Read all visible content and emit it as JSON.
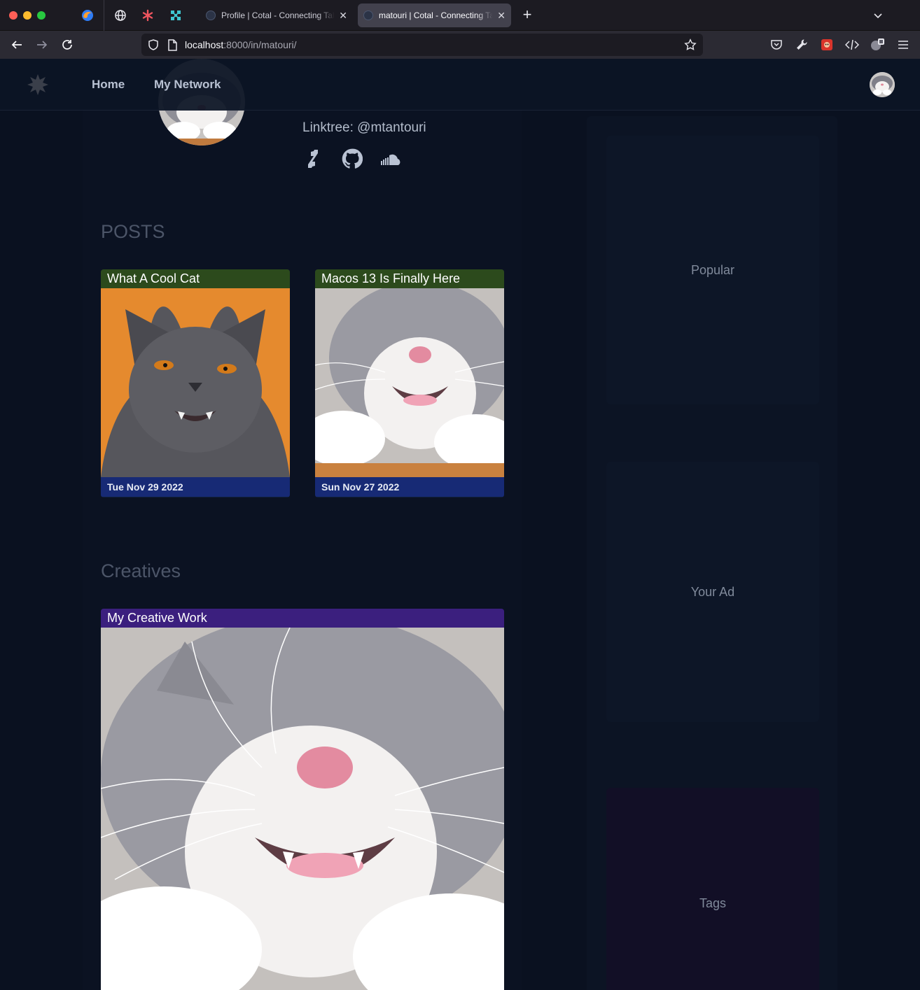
{
  "browser": {
    "tabs": [
      {
        "title": "Profile | Cotal - Connecting Talent",
        "active": false
      },
      {
        "title": "matouri | Cotal - Connecting Talent",
        "active": true
      }
    ],
    "url_host": "localhost",
    "url_path": ":8000/in/matouri/",
    "icons": [
      "firefox-icon",
      "globe-icon",
      "asterisk-icon",
      "puzzle-icon",
      "star-icon",
      "pocket-icon",
      "wrench-icon",
      "extension-icon",
      "devtools-icon",
      "sync-icon",
      "menu-icon"
    ]
  },
  "header": {
    "nav": {
      "home": "Home",
      "network": "My Network"
    }
  },
  "profile": {
    "linktree": "Linktree: @mtantouri",
    "socials": [
      "deviantart-icon",
      "github-icon",
      "soundcloud-icon"
    ]
  },
  "posts": {
    "heading": "POSTS",
    "items": [
      {
        "title": "What A Cool Cat",
        "date": "Tue Nov 29 2022",
        "color": "#2c4a1c"
      },
      {
        "title": "Macos 13 Is Finally Here",
        "date": "Sun Nov 27 2022",
        "color": "#2c4a1c"
      }
    ]
  },
  "creatives": {
    "heading": "Creatives",
    "items": [
      {
        "title": "My Creative Work",
        "color": "#3b1f7e"
      }
    ]
  },
  "sidebar": {
    "popular": "Popular",
    "ad": "Your Ad",
    "tags": "Tags"
  }
}
